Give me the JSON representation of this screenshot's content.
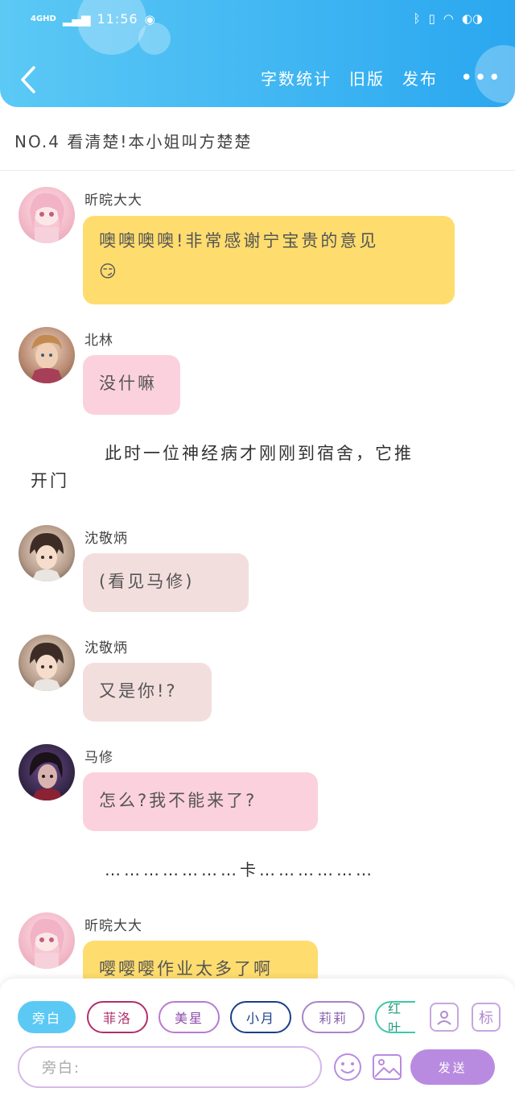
{
  "status_bar": {
    "network": "4GHD",
    "time": "11:56"
  },
  "header": {
    "actions": [
      "字数统计",
      "旧版",
      "发布"
    ],
    "more": "•••"
  },
  "story_title": "NO.4 看清楚!本小姐叫方楚楚",
  "messages": [
    {
      "name": "昕晥大大",
      "text": "噢噢噢噢!非常感谢宁宝贵的意见",
      "emoji": "😏",
      "bubble_color": "#fedd6e"
    },
    {
      "name": "北林",
      "text": "没什嘛",
      "bubble_color": "#fcd1de"
    },
    {
      "name": "沈敬炳",
      "text": "(看见马修)",
      "bubble_color": "#f3dede"
    },
    {
      "name": "沈敬炳",
      "text": "又是你!?",
      "bubble_color": "#f3dede"
    },
    {
      "name": "马修",
      "text": "怎么?我不能来了?",
      "bubble_color": "#fcd1de"
    },
    {
      "name": "昕晥大大",
      "text": "嘤嘤嘤作业太多了啊",
      "bubble_color": "#fedd6e"
    }
  ],
  "narration": "此时一位神经病才刚刚到宿舍，它推开门",
  "narration_line1": "此时一位神经病才刚刚到宿舍，它推",
  "narration_line2": "开门",
  "ellipsis_line": "…………………卡………………",
  "bottom": {
    "chips": [
      {
        "label": "旁白",
        "color": "#5cc9f5",
        "active": true
      },
      {
        "label": "菲洛",
        "color": "#b0306e"
      },
      {
        "label": "美星",
        "color": "#b77bd0"
      },
      {
        "label": "小月",
        "color": "#1a3f8a"
      },
      {
        "label": "莉莉",
        "color": "#a985c8"
      },
      {
        "label": "红叶",
        "color": "#3cc9a6"
      }
    ],
    "tag_icon_label": "标",
    "input_placeholder": "旁白:",
    "send_label": "发送"
  },
  "colors": {
    "header_start": "#5cc9f5",
    "header_end": "#2aa7f0",
    "send": "#b98be0"
  }
}
